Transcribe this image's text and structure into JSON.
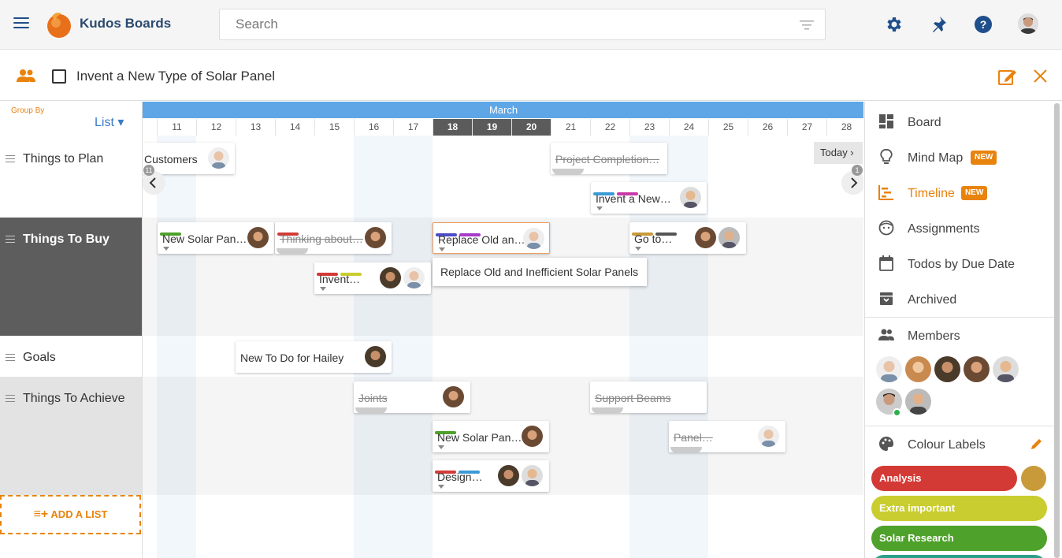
{
  "app": {
    "brand": "Kudos Boards"
  },
  "search": {
    "placeholder": "Search"
  },
  "board": {
    "title": "Invent a New Type of Solar Panel"
  },
  "left": {
    "group_by_label": "Group By",
    "group_by_value": "List ▾",
    "lanes": [
      "Things to Plan",
      "Things To Buy",
      "Goals",
      "Things To Achieve"
    ],
    "add_list": "ADD A LIST"
  },
  "timeline": {
    "month": "March",
    "days": [
      "11",
      "12",
      "13",
      "14",
      "15",
      "16",
      "17",
      "18",
      "19",
      "20",
      "21",
      "22",
      "23",
      "24",
      "25",
      "26",
      "27",
      "28"
    ],
    "highlight_days": [
      "18",
      "19",
      "20"
    ],
    "today": "Today ›",
    "left_badge": "11",
    "right_badge": "1",
    "tooltip": "Replace Old and Inefficient Solar Panels",
    "cards": [
      {
        "title": "Customers",
        "done": false
      },
      {
        "title": "Project Completion…",
        "done": true
      },
      {
        "title": "Invent a New…",
        "done": false
      },
      {
        "title": "New Solar Pan…",
        "done": false
      },
      {
        "title": "Thinking about…",
        "done": true
      },
      {
        "title": "Replace Old an…",
        "done": false
      },
      {
        "title": "Go to…",
        "done": false
      },
      {
        "title": "Invent…",
        "done": false
      },
      {
        "title": "New To Do for Hailey",
        "done": false
      },
      {
        "title": "Joints",
        "done": true
      },
      {
        "title": "Support Beams",
        "done": true
      },
      {
        "title": "New Solar Pan…",
        "done": false
      },
      {
        "title": "Panel…",
        "done": true
      },
      {
        "title": "Design…",
        "done": false
      }
    ]
  },
  "sidebar": {
    "nav": [
      {
        "label": "Board",
        "icon": "board-icon"
      },
      {
        "label": "Mind Map",
        "icon": "lightbulb-icon",
        "badge": "NEW"
      },
      {
        "label": "Timeline",
        "icon": "timeline-icon",
        "badge": "NEW",
        "active": true
      },
      {
        "label": "Assignments",
        "icon": "face-icon"
      },
      {
        "label": "Todos by Due Date",
        "icon": "calendar-icon"
      },
      {
        "label": "Archived",
        "icon": "archive-icon"
      }
    ],
    "members_label": "Members",
    "colour_labels_title": "Colour Labels",
    "colour_labels": [
      {
        "name": "Analysis",
        "color": "#d43a35"
      },
      {
        "name": "Extra important",
        "color": "#c9cd2f"
      },
      {
        "name": "Solar Research",
        "color": "#4ea12a"
      }
    ]
  },
  "colors": {
    "accent": "#e8830e",
    "month_bar": "#5ea6e6",
    "dark_lane": "#5d5d5d"
  }
}
